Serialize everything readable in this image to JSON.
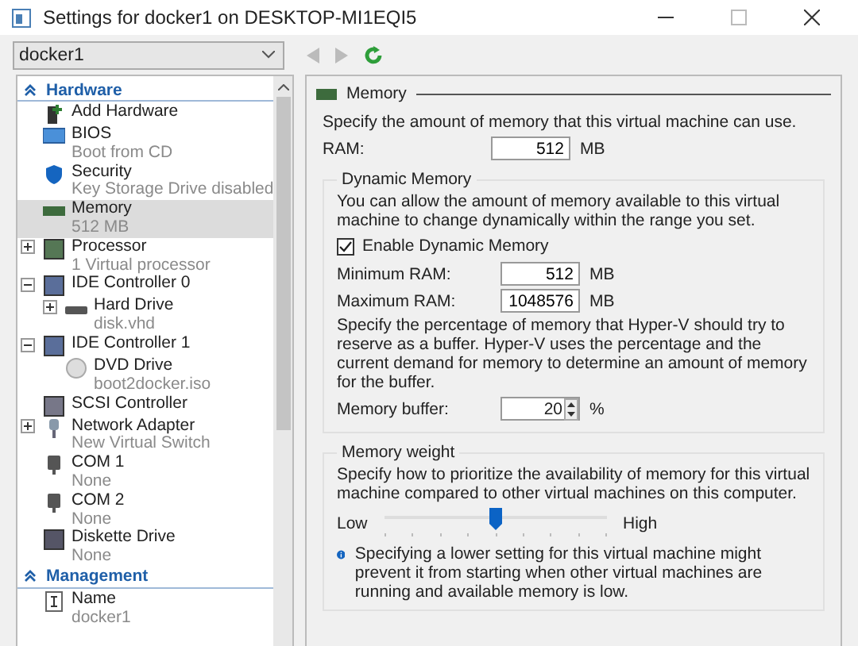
{
  "window": {
    "title": "Settings for docker1 on DESKTOP-MI1EQI5"
  },
  "vm_selector": {
    "value": "docker1"
  },
  "sidebar": {
    "sections": [
      {
        "title": "Hardware",
        "expanded": true,
        "items": [
          {
            "kind": "add",
            "label": "Add Hardware",
            "selected": false
          },
          {
            "kind": "bios",
            "label": "BIOS",
            "detail": "Boot from CD",
            "selected": false
          },
          {
            "kind": "security",
            "label": "Security",
            "detail": "Key Storage Drive disabled",
            "selected": false
          },
          {
            "kind": "memory",
            "label": "Memory",
            "detail": "512 MB",
            "selected": true
          },
          {
            "kind": "processor",
            "label": "Processor",
            "detail": "1 Virtual processor",
            "selected": false,
            "expanded": false
          },
          {
            "kind": "controller",
            "label": "IDE Controller 0",
            "selected": false,
            "expanded": true,
            "children": [
              {
                "kind": "disk",
                "label": "Hard Drive",
                "detail": "disk.vhd",
                "selected": false,
                "expanded": false
              }
            ]
          },
          {
            "kind": "controller",
            "label": "IDE Controller 1",
            "selected": false,
            "expanded": true,
            "children": [
              {
                "kind": "dvd",
                "label": "DVD Drive",
                "detail": "boot2docker.iso",
                "selected": false
              }
            ]
          },
          {
            "kind": "scsi",
            "label": "SCSI Controller",
            "selected": false
          },
          {
            "kind": "network",
            "label": "Network Adapter",
            "detail": "New Virtual Switch",
            "selected": false,
            "expanded": false
          },
          {
            "kind": "com",
            "label": "COM 1",
            "detail": "None",
            "selected": false
          },
          {
            "kind": "com",
            "label": "COM 2",
            "detail": "None",
            "selected": false
          },
          {
            "kind": "diskette",
            "label": "Diskette Drive",
            "detail": "None",
            "selected": false
          }
        ]
      },
      {
        "title": "Management",
        "expanded": true,
        "items": [
          {
            "kind": "name",
            "label": "Name",
            "detail": "docker1",
            "selected": false
          }
        ]
      }
    ]
  },
  "memory": {
    "title": "Memory",
    "intro": "Specify the amount of memory that this virtual machine can use.",
    "ram_label": "RAM:",
    "ram_value": "512",
    "ram_unit": "MB",
    "dynamic": {
      "title": "Dynamic Memory",
      "description": "You can allow the amount of memory available to this virtual machine to change dynamically within the range you set.",
      "enable_label": "Enable Dynamic Memory",
      "enabled": true,
      "min_label": "Minimum RAM:",
      "min_value": "512",
      "min_unit": "MB",
      "max_label": "Maximum RAM:",
      "max_value": "1048576",
      "max_unit": "MB",
      "buffer_description": "Specify the percentage of memory that Hyper-V should try to reserve as a buffer. Hyper-V uses the percentage and the current demand for memory to determine an amount of memory for the buffer.",
      "buffer_label": "Memory buffer:",
      "buffer_value": "20",
      "buffer_unit": "%"
    },
    "weight": {
      "title": "Memory weight",
      "description": "Specify how to prioritize the availability of memory for this virtual machine compared to other virtual machines on this computer.",
      "low_label": "Low",
      "high_label": "High",
      "level": 0.5,
      "note": "Specifying a lower setting for this virtual machine might prevent it from starting when other virtual machines are running and available memory is low."
    }
  }
}
